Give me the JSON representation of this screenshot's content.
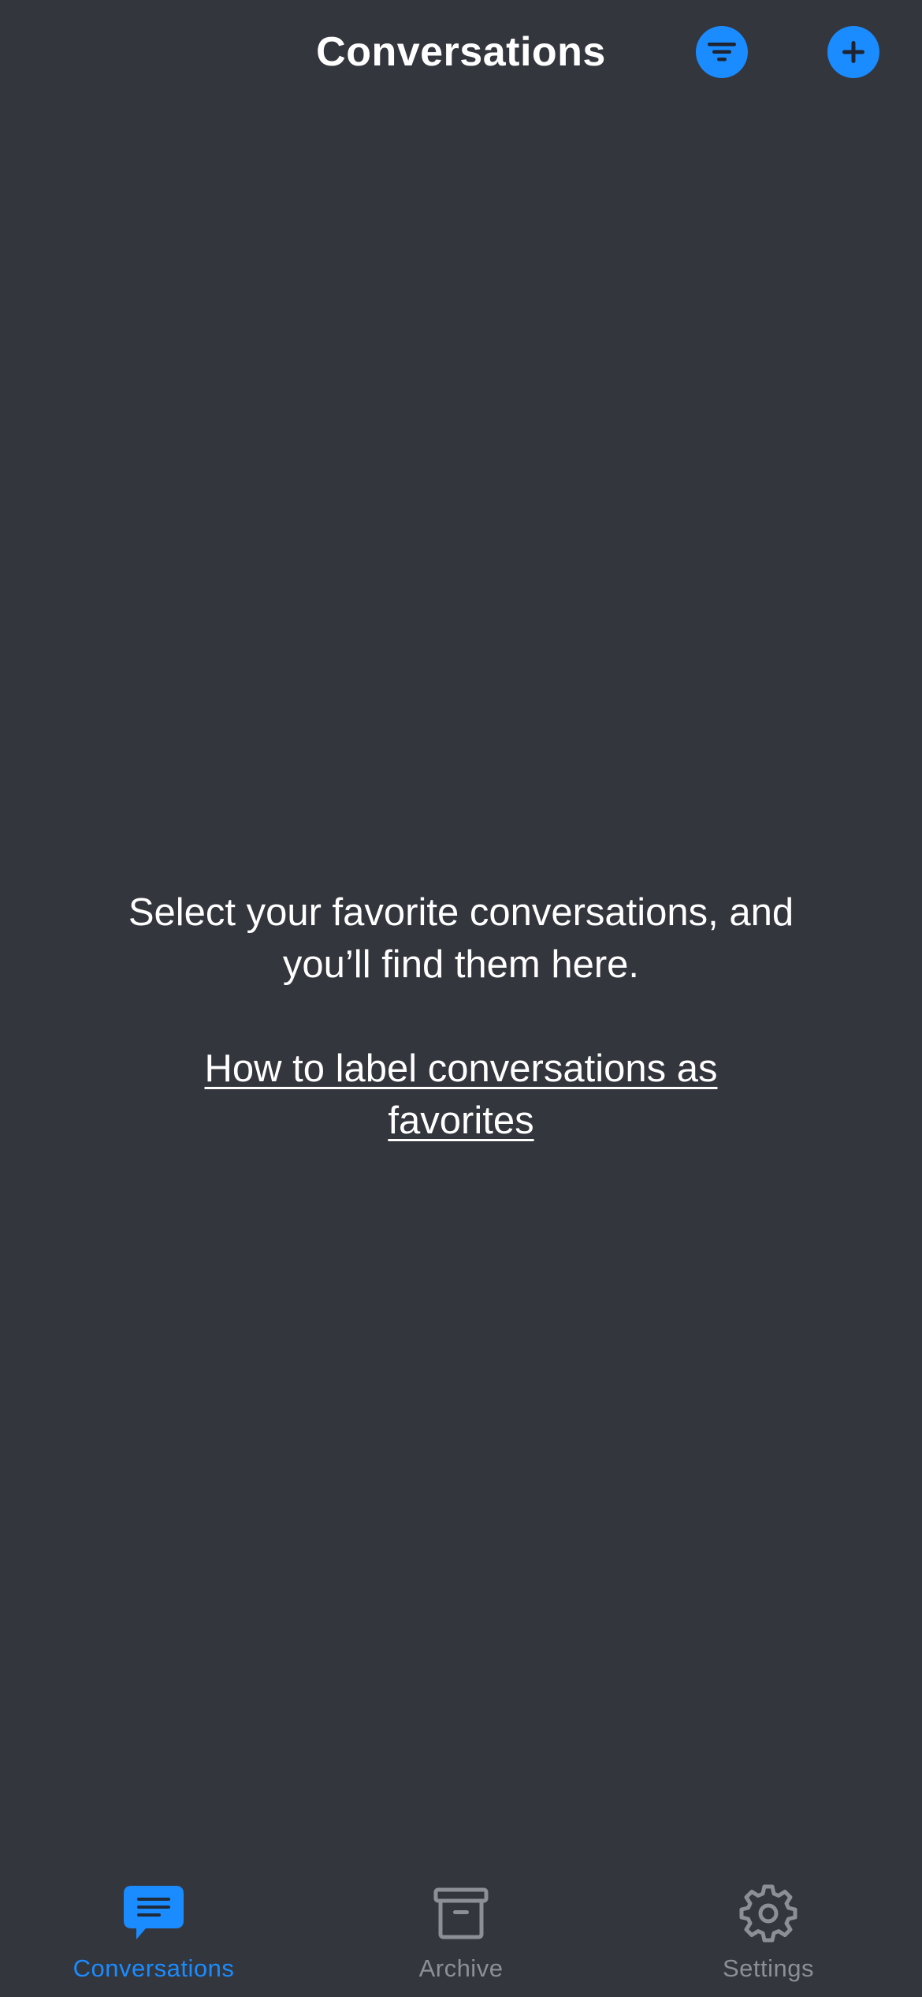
{
  "header": {
    "title": "Conversations",
    "filter_icon": "filter-icon",
    "add_icon": "plus-icon"
  },
  "empty_state": {
    "message": "Select your favorite conversations, and you’ll find them here.",
    "link_label": "How to label conversations as favorites"
  },
  "tabs": [
    {
      "label": "Conversations",
      "icon": "chat-bubble-icon",
      "active": true
    },
    {
      "label": "Archive",
      "icon": "archive-box-icon",
      "active": false
    },
    {
      "label": "Settings",
      "icon": "gear-icon",
      "active": false
    }
  ],
  "colors": {
    "background": "#34363e",
    "accent": "#1a8cff",
    "inactive": "#8d8f96",
    "text": "#ffffff"
  }
}
